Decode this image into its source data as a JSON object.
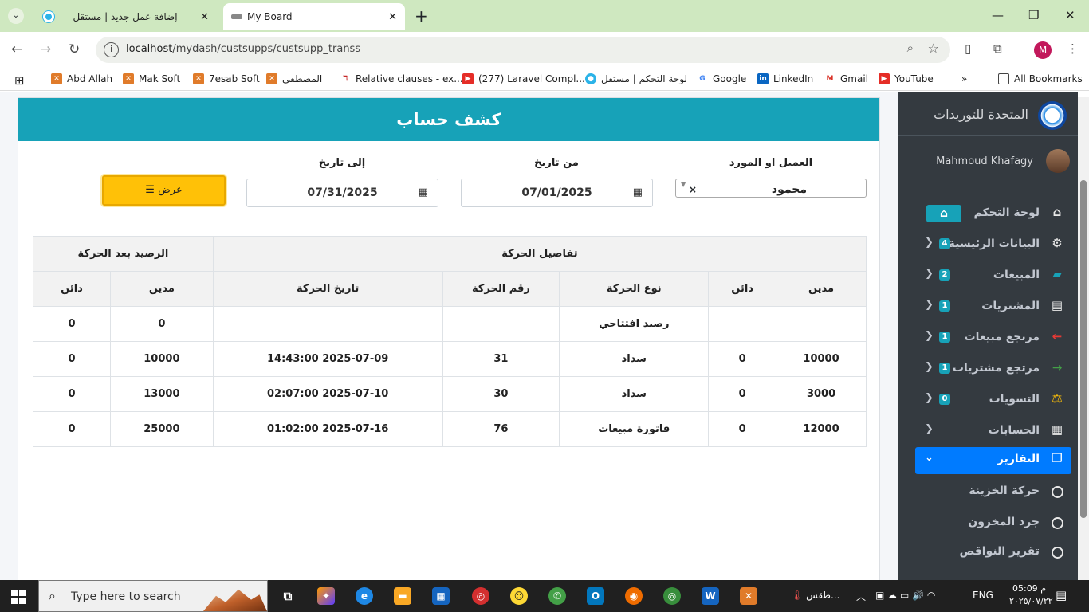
{
  "browser": {
    "tabs": [
      {
        "title": "إضافة عمل جديد | مستقل"
      },
      {
        "title": "My Board"
      }
    ],
    "url_host": "localhost",
    "url_path": "/mydash/custsupps/custsupp_transs",
    "profile_initial": "M",
    "bookmarks": [
      {
        "label": "Abd Allah"
      },
      {
        "label": "Mak Soft"
      },
      {
        "label": "7esab Soft"
      },
      {
        "label": "المصطفى"
      },
      {
        "label": "Relative clauses - ex..."
      },
      {
        "label": "(277) Laravel Compl..."
      },
      {
        "label": "لوحة التحكم | مستقل"
      },
      {
        "label": "Google"
      },
      {
        "label": "LinkedIn"
      },
      {
        "label": "Gmail"
      },
      {
        "label": "YouTube"
      }
    ],
    "more_bookmarks": "»",
    "all_bookmarks": "All Bookmarks"
  },
  "page": {
    "title": "كشف حساب",
    "customer_label": "العميل او المورد",
    "customer_value": "محمود",
    "from_label": "من تاريخ",
    "from_value": "07/01/2025",
    "to_label": "إلى تاريخ",
    "to_value": "07/31/2025",
    "view_button": "عرض",
    "table": {
      "group_details": "تفاصيل الحركة",
      "group_balance": "الرصيد بعد الحركة",
      "columns": [
        "مدين",
        "دائن",
        "نوع الحركة",
        "رقم الحركة",
        "تاريخ الحركة",
        "مدين",
        "دائن"
      ],
      "rows": [
        [
          "",
          "",
          "رصيد افتتاحي",
          "",
          "",
          "0",
          "0"
        ],
        [
          "10000",
          "0",
          "سداد",
          "31",
          "2025-07-09 14:43:00",
          "10000",
          "0"
        ],
        [
          "3000",
          "0",
          "سداد",
          "30",
          "2025-07-10 02:07:00",
          "13000",
          "0"
        ],
        [
          "12000",
          "0",
          "فاتورة مبيعات",
          "76",
          "2025-07-16 01:02:00",
          "25000",
          "0"
        ]
      ]
    }
  },
  "sidebar": {
    "brand": "المتحدة للتوريدات",
    "user": "Mahmoud Khafagy",
    "items": [
      {
        "label": "لوحة التحكم",
        "icon": "home-icon"
      },
      {
        "label": "البيانات الرئيسية",
        "badge": "4",
        "icon": "gears-icon"
      },
      {
        "label": "المبيعات",
        "badge": "2",
        "icon": "shopping-bag-icon"
      },
      {
        "label": "المشتريات",
        "badge": "1",
        "icon": "card-icon"
      },
      {
        "label": "مرتجع مبيعات",
        "badge": "1",
        "icon": "arrow-left-icon"
      },
      {
        "label": "مرتجع مشتريات",
        "badge": "1",
        "icon": "arrow-right-icon"
      },
      {
        "label": "التسويات",
        "badge": "0",
        "icon": "balance-scale-icon"
      },
      {
        "label": "الحسابات",
        "icon": "calculator-icon"
      },
      {
        "label": "التقارير",
        "icon": "copy-icon"
      }
    ],
    "sub_items": [
      {
        "label": "حركة الخزينة"
      },
      {
        "label": "جرد المخزون"
      },
      {
        "label": "تقرير النواقص"
      }
    ]
  },
  "taskbar": {
    "search_placeholder": "Type here to search",
    "weather": "طقس...",
    "language": "ENG",
    "time": "05:09 م",
    "date": "٢٠٢٥/٠٧/٢٢"
  },
  "colors": {
    "header": "#17a2b8",
    "sidebar": "#343a40",
    "active": "#007bff",
    "button": "#ffc107",
    "tabbar": "#cfe8c0"
  }
}
